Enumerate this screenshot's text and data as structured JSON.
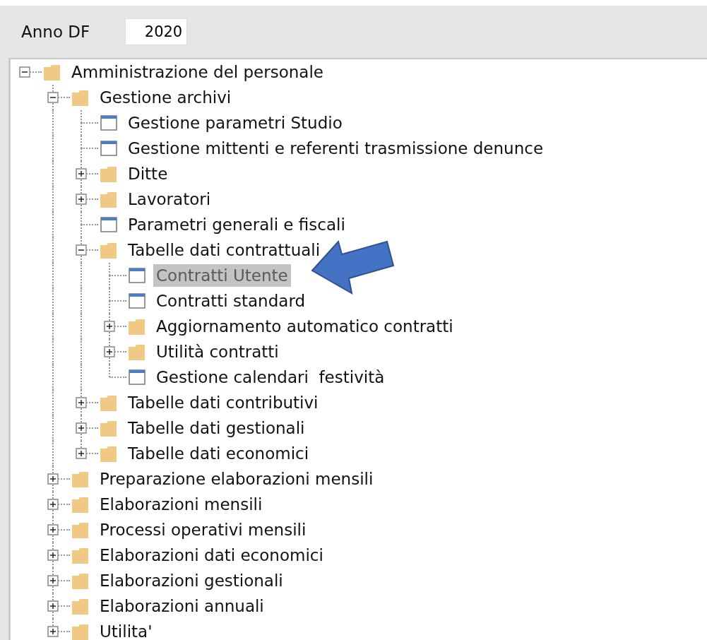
{
  "filter": {
    "label": "Anno DF",
    "value": "2020"
  },
  "tree": [
    {
      "label": "Amministrazione del personale",
      "kind": "folder",
      "expanded": true,
      "selected": false,
      "children": [
        {
          "label": "Gestione archivi",
          "kind": "folder",
          "expanded": true,
          "selected": false,
          "children": [
            {
              "label": "Gestione parametri Studio",
              "kind": "form",
              "selected": false
            },
            {
              "label": "Gestione mittenti e referenti trasmissione denunce",
              "kind": "form",
              "selected": false
            },
            {
              "label": "Ditte",
              "kind": "folder",
              "expanded": false,
              "selected": false
            },
            {
              "label": "Lavoratori",
              "kind": "folder",
              "expanded": false,
              "selected": false
            },
            {
              "label": "Parametri generali e fiscali",
              "kind": "form",
              "selected": false
            },
            {
              "label": "Tabelle dati contrattuali",
              "kind": "folder",
              "expanded": true,
              "selected": false,
              "children": [
                {
                  "label": "Contratti Utente",
                  "kind": "form",
                  "selected": true
                },
                {
                  "label": "Contratti standard",
                  "kind": "form",
                  "selected": false
                },
                {
                  "label": "Aggiornamento automatico contratti",
                  "kind": "folder",
                  "expanded": false,
                  "selected": false
                },
                {
                  "label": "Utilità contratti",
                  "kind": "folder",
                  "expanded": false,
                  "selected": false
                },
                {
                  "label": "Gestione calendari  festività",
                  "kind": "form",
                  "selected": false
                }
              ]
            },
            {
              "label": "Tabelle dati contributivi",
              "kind": "folder",
              "expanded": false,
              "selected": false
            },
            {
              "label": "Tabelle dati gestionali",
              "kind": "folder",
              "expanded": false,
              "selected": false
            },
            {
              "label": "Tabelle dati economici",
              "kind": "folder",
              "expanded": false,
              "selected": false
            }
          ]
        },
        {
          "label": "Preparazione elaborazioni mensili",
          "kind": "folder",
          "expanded": false,
          "selected": false
        },
        {
          "label": "Elaborazioni mensili",
          "kind": "folder",
          "expanded": false,
          "selected": false
        },
        {
          "label": "Processi operativi mensili",
          "kind": "folder",
          "expanded": false,
          "selected": false
        },
        {
          "label": "Elaborazioni dati economici",
          "kind": "folder",
          "expanded": false,
          "selected": false
        },
        {
          "label": "Elaborazioni gestionali",
          "kind": "folder",
          "expanded": false,
          "selected": false
        },
        {
          "label": "Elaborazioni annuali",
          "kind": "folder",
          "expanded": false,
          "selected": false
        },
        {
          "label": "Utilita'",
          "kind": "folder",
          "expanded": false,
          "selected": false
        }
      ]
    }
  ]
}
